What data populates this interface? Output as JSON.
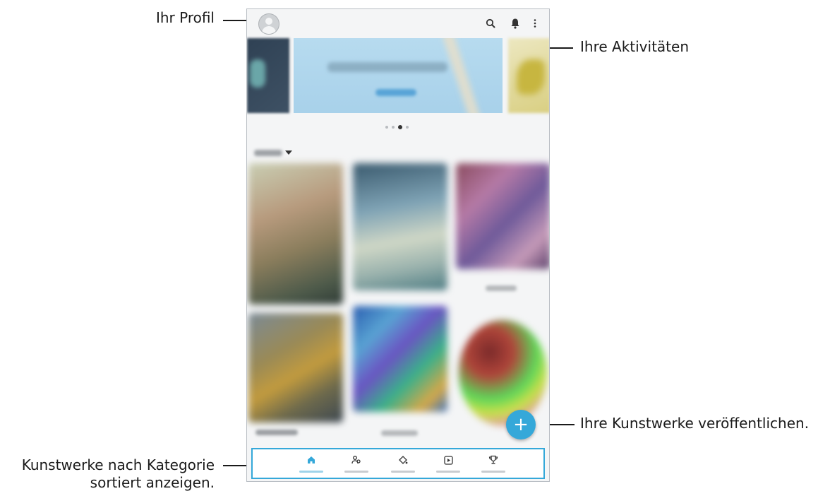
{
  "annotations": {
    "profile": "Ihr Profil",
    "activities": "Ihre Aktivitäten",
    "publish": "Ihre Kunstwerke veröffentlichen.",
    "categories_line1": "Kunstwerke nach Kategorie",
    "categories_line2": "sortiert anzeigen."
  },
  "colors": {
    "accent": "#35a8d9",
    "annotation_text": "#1a1a1a",
    "frame_border": "#b9bec4"
  },
  "icons": {
    "top_bar": [
      "avatar-icon",
      "search-icon",
      "bell-icon",
      "more-vertical-icon"
    ],
    "fab": "plus-icon",
    "bottom_nav": [
      "home-icon",
      "people-icon",
      "paint-bucket-icon",
      "play-square-icon",
      "trophy-icon"
    ]
  },
  "banner": {
    "page_count": 4,
    "active_page": 3
  },
  "fab_symbol": "+"
}
